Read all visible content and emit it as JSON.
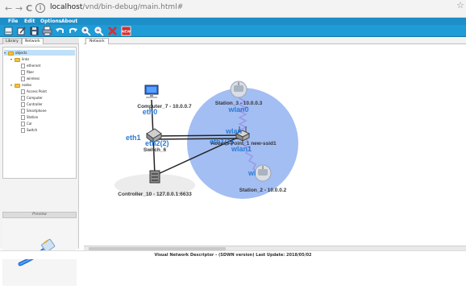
{
  "browser": {
    "back": "←",
    "forward": "→",
    "reload": "C",
    "url_host": "localhost",
    "url_path": "/vnd/bin-debug/main.html#",
    "star": "☆"
  },
  "menu": [
    "File",
    "Edit",
    "Options",
    "About"
  ],
  "toolbar_icons": [
    "app-icon",
    "edit-icon",
    "save-icon",
    "print-icon",
    "undo-icon",
    "redo-icon",
    "zoom-in-icon",
    "zoom-out-icon",
    "delete-icon",
    "new-icon"
  ],
  "left": {
    "tabs": [
      "Library",
      "Network"
    ],
    "tree": {
      "root": "objects",
      "links_label": "links",
      "links": [
        "ethernet",
        "fiber",
        "wireless"
      ],
      "nodes_label": "nodes",
      "nodes": [
        "Access Point",
        "Computer",
        "Controller",
        "Smartphone",
        "Station",
        "Car",
        "Switch"
      ]
    },
    "preview_title": "Preview"
  },
  "main": {
    "tab": "Network"
  },
  "topology": {
    "computer": "Computer_7 - 10.0.0.7",
    "switch": "Switch_6",
    "controller": "Controller_10 - 127.0.0.1:6633",
    "access_point": "Access Point_1 new-ssid1",
    "station3": "Station_3 - 10.0.0.3",
    "station2": "Station_2 - 10.0.0.2",
    "ifaces": {
      "comp_eth0": "eth0",
      "sw_eth1": "eth1",
      "sw_eth2": "eth2(2)",
      "ap_eth1": "eth1(1)",
      "ap_wlan": "wlan",
      "ap_wlan1": "wlan1",
      "st3_wlan0": "wlan0",
      "st2_wlan": "wl"
    },
    "range_color": "#8fb0f0"
  },
  "footer": "Visual Network Descriptor - (SDWN version)  Last Update: 2018/05/02"
}
